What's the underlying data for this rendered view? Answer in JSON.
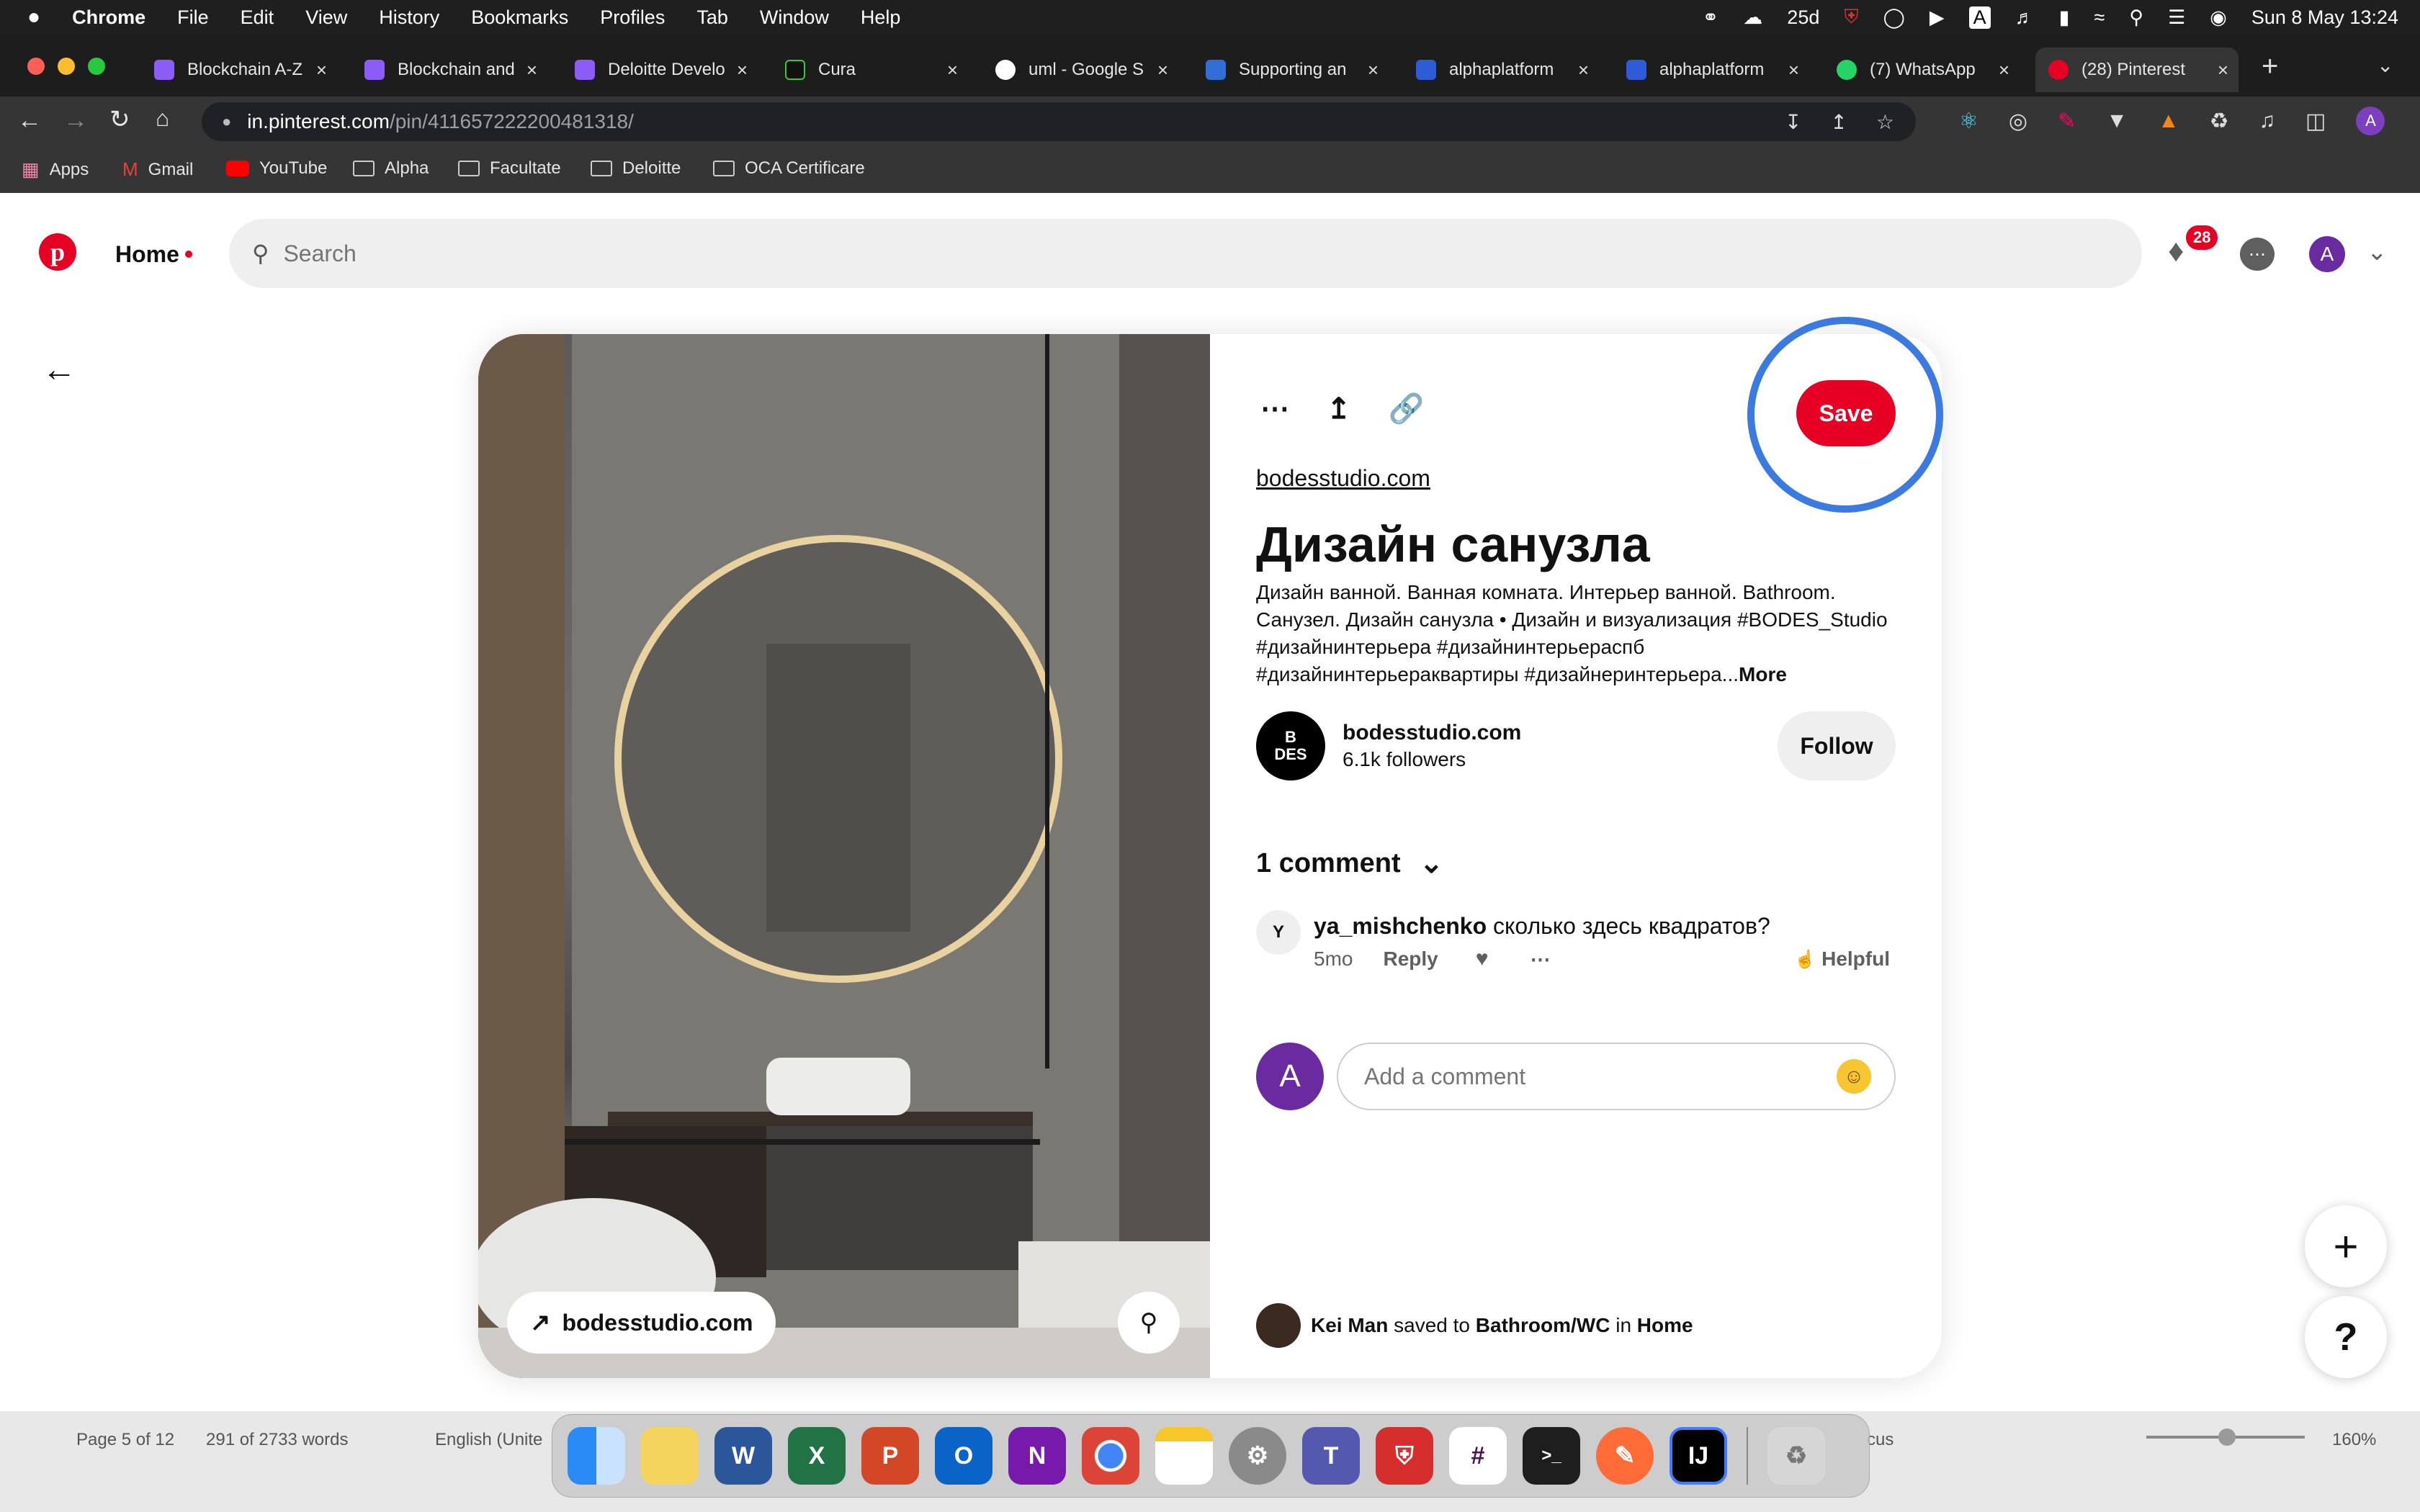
{
  "menubar": {
    "app": "Chrome",
    "items": [
      "File",
      "Edit",
      "View",
      "History",
      "Bookmarks",
      "Profiles",
      "Tab",
      "Window",
      "Help"
    ],
    "status_text": "25d",
    "clock": "Sun 8 May  13:24"
  },
  "tabs": [
    {
      "title": "Blockchain A-Z",
      "color": "#8b5cf6"
    },
    {
      "title": "Blockchain and",
      "color": "#8b5cf6"
    },
    {
      "title": "Deloitte Develo",
      "color": "#8b5cf6"
    },
    {
      "title": "Cura",
      "color": "#111111"
    },
    {
      "title": "uml - Google S",
      "color": "#ffffff"
    },
    {
      "title": "Supporting an",
      "color": "#2f6fd6"
    },
    {
      "title": "alphaplatform",
      "color": "#2e5bd8"
    },
    {
      "title": "alphaplatform",
      "color": "#2e5bd8"
    },
    {
      "title": "(7) WhatsApp",
      "color": "#25d366"
    },
    {
      "title": "(28) Pinterest",
      "color": "#e60023"
    }
  ],
  "url": {
    "domain": "in.pinterest.com",
    "path": "/pin/411657222200481318/"
  },
  "bookmarks": [
    "Apps",
    "Gmail",
    "YouTube",
    "Alpha",
    "Facultate",
    "Deloitte",
    "OCA Certificare"
  ],
  "pinterest": {
    "home_label": "Home",
    "search_placeholder": "Search",
    "notif_count": "28",
    "avatar_letter": "A"
  },
  "pin": {
    "source_link": "bodesstudio.com",
    "title": "Дизайн санузла",
    "description": "Дизайн ванной. Ванная комната. Интерьер ванной. Bathroom. Санузел. Дизайн санузла • Дизайн и визуализация #BODES_Studio #дизайнинтерьера #дизайнинтерьераспб #дизайнинтерьераквартиры #дизайнеринтерьера...",
    "more_label": "More",
    "save_label": "Save",
    "image_link_label": "bodesstudio.com",
    "author": {
      "name": "bodesstudio.com",
      "followers": "6.1k followers",
      "logo_line1": "B",
      "logo_line2": "DES"
    },
    "follow_label": "Follow",
    "comments_header": "1 comment",
    "comment": {
      "avatar_letter": "Y",
      "username": "ya_mishchenko",
      "text": "сколько здесь квадратов?",
      "time": "5mo",
      "reply_label": "Reply",
      "helpful_label": "Helpful"
    },
    "add_comment_placeholder": "Add a comment",
    "my_avatar_letter": "A",
    "saved_by": {
      "name": "Kei Man",
      "verb": "saved to",
      "board": "Bathroom/WC",
      "prep": "in",
      "section": "Home"
    }
  },
  "word_status": {
    "page": "Page 5 of 12",
    "words": "291 of 2733 words",
    "lang": "English (Unite",
    "focus": "cus",
    "zoom": "160%"
  },
  "colors": {
    "pinterest_red": "#e60023",
    "annotation_blue": "#3b7be0"
  }
}
